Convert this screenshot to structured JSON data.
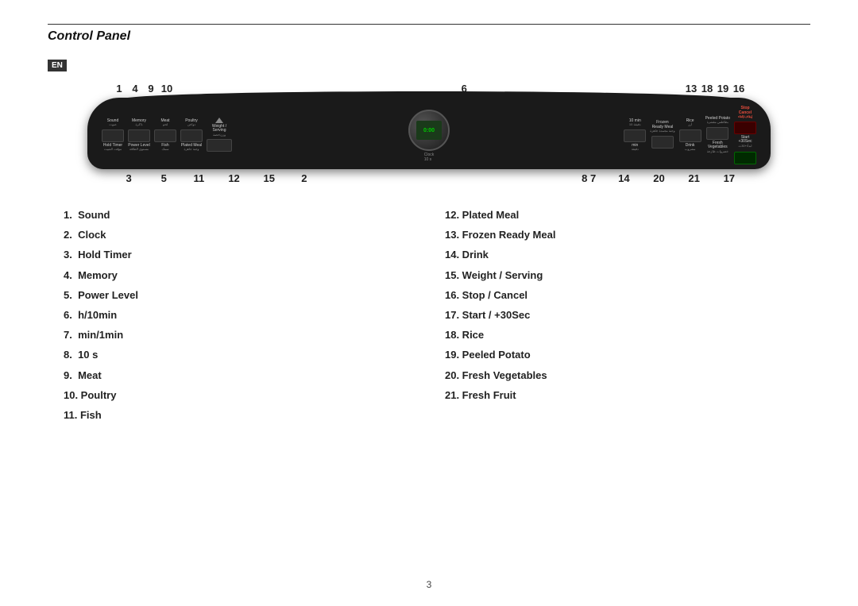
{
  "title": "Control Panel",
  "en_badge": "EN",
  "page_number": "3",
  "top_numbers": [
    "1",
    "4",
    "9",
    "10",
    "",
    "6",
    "",
    "13",
    "18",
    "19",
    "16"
  ],
  "bottom_numbers": [
    "3",
    "5",
    "11",
    "12",
    "15",
    "2",
    "",
    "8",
    "7",
    "14",
    "20",
    "21",
    "17"
  ],
  "legend_left": [
    {
      "num": "1.",
      "label": "Sound"
    },
    {
      "num": "2.",
      "label": "Clock"
    },
    {
      "num": "3.",
      "label": "Hold Timer"
    },
    {
      "num": "4.",
      "label": "Memory"
    },
    {
      "num": "5.",
      "label": "Power Level"
    },
    {
      "num": "6.",
      "label": "h/10min"
    },
    {
      "num": "7.",
      "label": "min/1min"
    },
    {
      "num": "8.",
      "label": "10 s"
    },
    {
      "num": "9.",
      "label": "Meat"
    },
    {
      "num": "10.",
      "label": "Poultry"
    },
    {
      "num": "11.",
      "label": "Fish"
    }
  ],
  "legend_right": [
    {
      "num": "12.",
      "label": "Plated Meal"
    },
    {
      "num": "13.",
      "label": "Frozen Ready Meal"
    },
    {
      "num": "14.",
      "label": "Drink"
    },
    {
      "num": "15.",
      "label": "Weight / Serving"
    },
    {
      "num": "16.",
      "label": "Stop / Cancel"
    },
    {
      "num": "17.",
      "label": "Start / +30Sec"
    },
    {
      "num": "18.",
      "label": "Rice"
    },
    {
      "num": "19.",
      "label": "Peeled Potato"
    },
    {
      "num": "20.",
      "label": "Fresh Vegetables"
    },
    {
      "num": "21.",
      "label": "Fresh Fruit"
    }
  ],
  "buttons": [
    {
      "top": "Sound",
      "bottom": ""
    },
    {
      "top": "Memory",
      "bottom": ""
    },
    {
      "top": "Meat",
      "bottom": ""
    },
    {
      "top": "Poultry",
      "bottom": "Fish"
    },
    {
      "top": "Weight/Serving",
      "bottom": "Plated Meal"
    },
    {
      "top": "10min",
      "bottom": "min"
    },
    {
      "top": "Frozen Ready Meal",
      "bottom": ""
    },
    {
      "top": "Rice",
      "bottom": "Drink"
    },
    {
      "top": "Peeled Potato",
      "bottom": "Fresh Vegetables/Fresh Fruit"
    },
    {
      "top": "Stop/Cancel",
      "bottom": "Start/+30Sec"
    }
  ]
}
